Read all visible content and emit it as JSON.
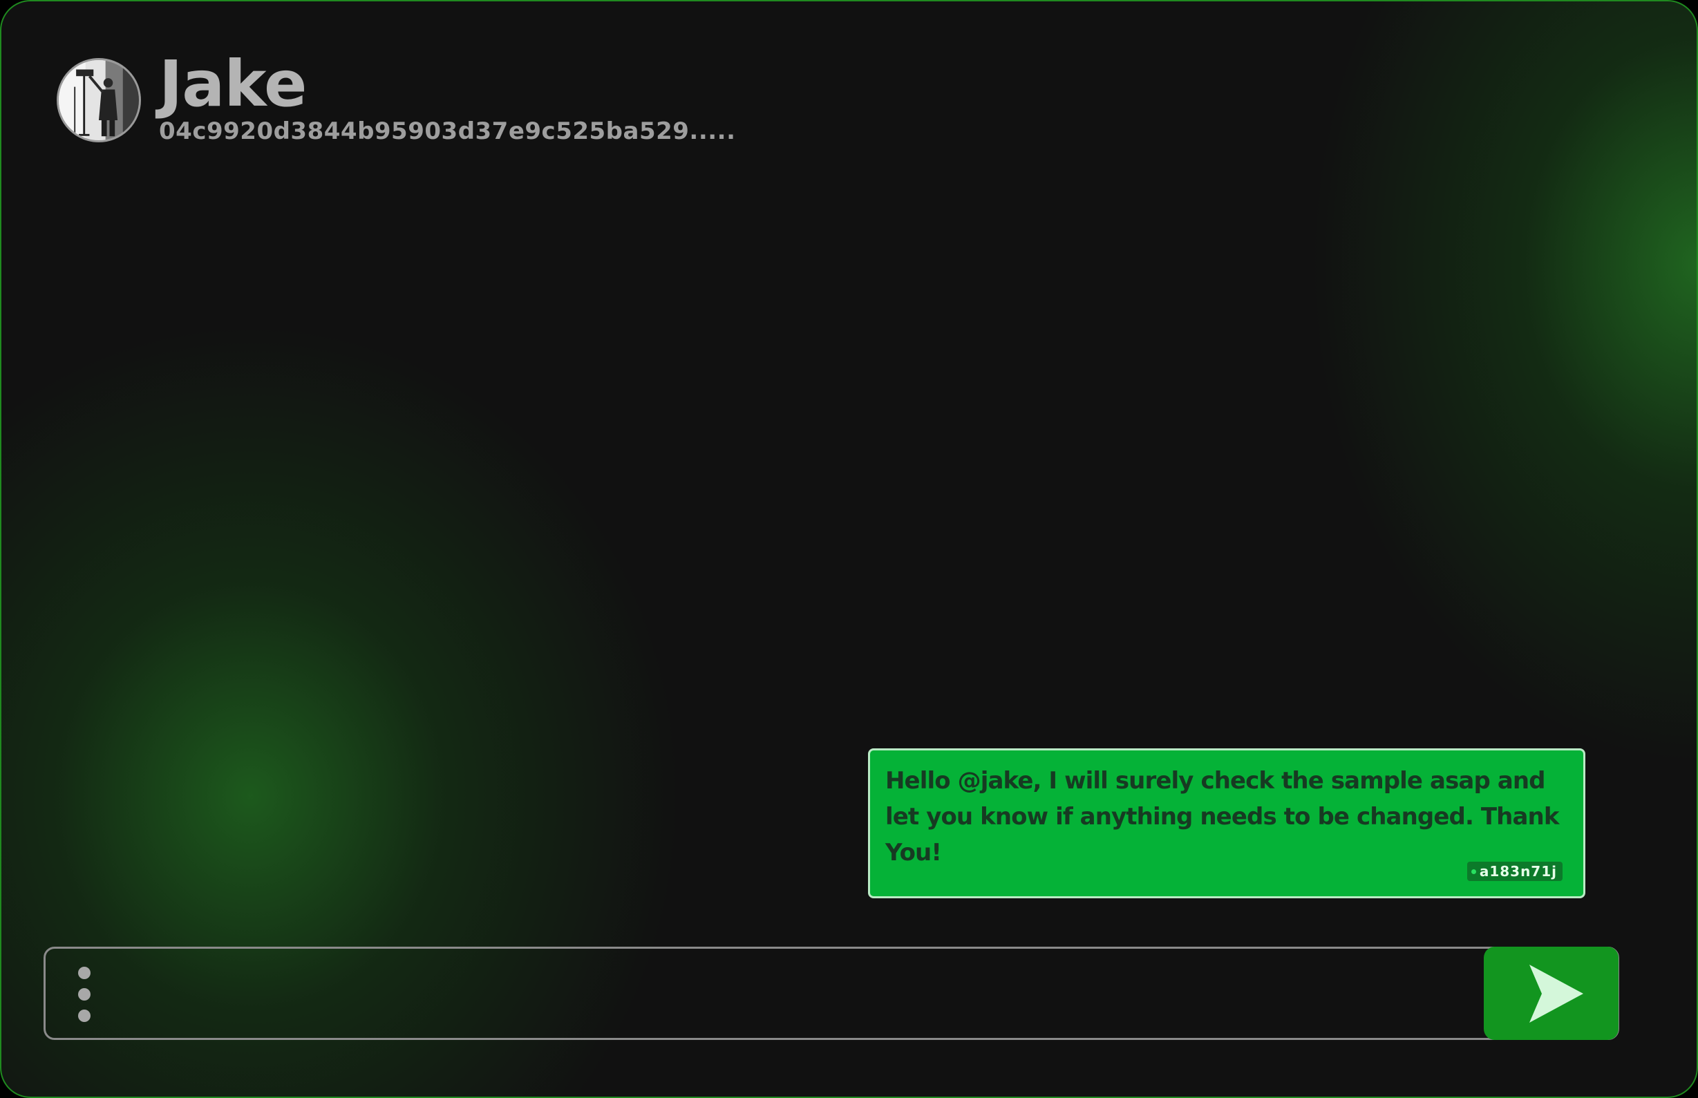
{
  "contact": {
    "name": "Jake",
    "id": "04c9920d3844b95903d37e9c525ba529....."
  },
  "messages": [
    {
      "text": "Hello @jake, I will surely check the sample asap and let you know if anything needs to be changed. Thank You!",
      "sender_tag": "a183n71j",
      "direction": "outgoing"
    }
  ],
  "composer": {
    "placeholder": "",
    "menu_icon": "vertical-dots-icon",
    "send_icon": "send-arrow-icon"
  },
  "colors": {
    "background": "#111111",
    "accent_green": "#05b237",
    "send_button": "#12951f",
    "window_border": "#1f8a1f"
  }
}
